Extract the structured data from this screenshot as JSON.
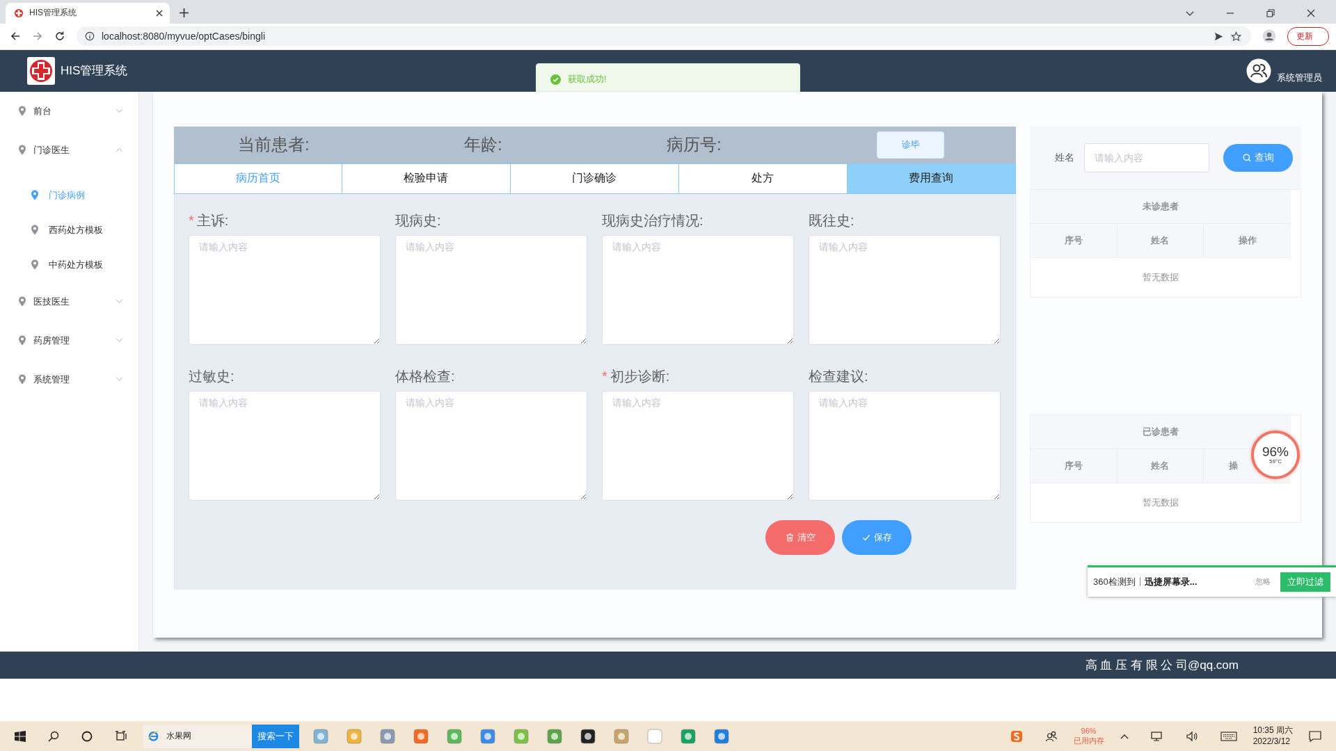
{
  "browser": {
    "tab_title": "HIS管理系统",
    "url": "localhost:8080/myvue/optCases/bingli",
    "update_button": "更新"
  },
  "header": {
    "title": "HIS管理系统",
    "user": "系统管理员"
  },
  "toast": {
    "message": "获取成功!"
  },
  "sidebar": {
    "items": [
      {
        "label": "前台",
        "expanded": false
      },
      {
        "label": "门诊医生",
        "expanded": true,
        "children": [
          {
            "label": "门诊病例",
            "selected": true
          },
          {
            "label": "西药处方模板",
            "selected": false
          },
          {
            "label": "中药处方模板",
            "selected": false
          }
        ]
      },
      {
        "label": "医技医生",
        "expanded": false
      },
      {
        "label": "药房管理",
        "expanded": false
      },
      {
        "label": "系统管理",
        "expanded": false
      }
    ]
  },
  "patient_bar": {
    "fields": [
      "当前患者:",
      "年龄:",
      "病历号:"
    ],
    "finish_button": "诊毕"
  },
  "tabs": [
    {
      "label": "病历首页",
      "selected": true,
      "highlighted": false
    },
    {
      "label": "检验申请",
      "selected": false,
      "highlighted": false
    },
    {
      "label": "门诊确诊",
      "selected": false,
      "highlighted": false
    },
    {
      "label": "处方",
      "selected": false,
      "highlighted": false
    },
    {
      "label": "费用查询",
      "selected": false,
      "highlighted": true
    }
  ],
  "form": {
    "fields": [
      {
        "label": "主诉:",
        "required": true,
        "required_mark": "*",
        "placeholder": "请输入内容"
      },
      {
        "label": "现病史:",
        "required": false,
        "placeholder": "请输入内容"
      },
      {
        "label": "现病史治疗情况:",
        "required": false,
        "placeholder": "请输入内容"
      },
      {
        "label": "既往史:",
        "required": false,
        "placeholder": "请输入内容"
      },
      {
        "label": "过敏史:",
        "required": false,
        "placeholder": "请输入内容"
      },
      {
        "label": "体格检查:",
        "required": false,
        "placeholder": "请输入内容"
      },
      {
        "label": "初步诊断:",
        "required": true,
        "required_mark": "*",
        "placeholder": "请输入内容"
      },
      {
        "label": "检查建议:",
        "required": false,
        "placeholder": "请输入内容"
      }
    ]
  },
  "actions": [
    {
      "kind": "clear",
      "label": "清空"
    },
    {
      "kind": "save",
      "label": "保存"
    }
  ],
  "search": {
    "label": "姓名",
    "placeholder": "请输入内容",
    "button": "查询"
  },
  "tables": [
    {
      "title": "未诊患者",
      "columns": [
        "序号",
        "姓名",
        "操作"
      ],
      "empty_text": "暂无数据"
    },
    {
      "title": "已诊患者",
      "columns": [
        "序号",
        "姓名",
        "操"
      ],
      "empty_text": "暂无数据"
    }
  ],
  "footer": {
    "text": "高 血 压 有 限 公 司@qq.com"
  },
  "popup": {
    "source": "360检测到",
    "app": "迅捷屏幕录...",
    "ignore": "忽略",
    "action": "立即过滤"
  },
  "gauge": {
    "value": "96%",
    "temperature": "59°C"
  },
  "taskbar": {
    "search_value": "水果网",
    "search_button": "搜索一下",
    "memory_value": "96%",
    "memory_label": "已用内存",
    "time": "10:35 周六",
    "date": "2022/3/12"
  }
}
